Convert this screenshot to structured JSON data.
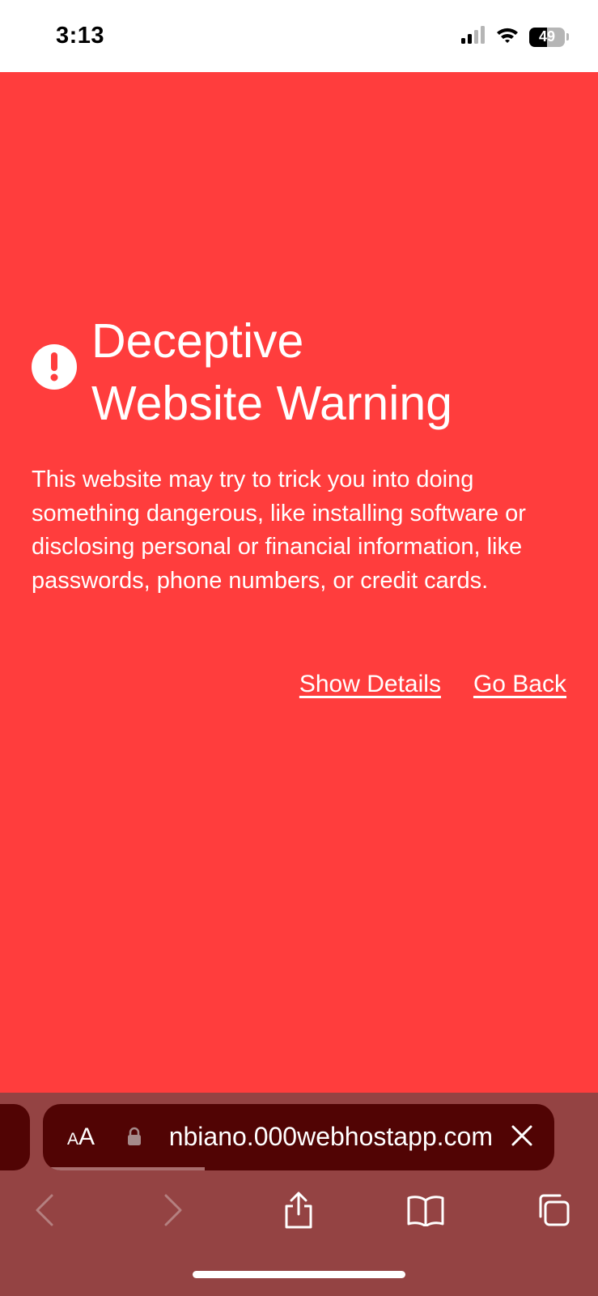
{
  "status_bar": {
    "time": "3:13",
    "battery_level": "49",
    "signal_icon": "cellular-signal-icon",
    "wifi_icon": "wifi-icon"
  },
  "warning": {
    "icon": "exclamation-icon",
    "title_line1": "Deceptive",
    "title_line2": "Website Warning",
    "body": "This website may try to trick you into doing something dangerous, like installing software or disclosing personal or financial information, like passwords, phone numbers, or credit cards.",
    "show_details_label": "Show Details",
    "go_back_label": "Go Back"
  },
  "browser": {
    "text_size_label_small": "A",
    "text_size_label_large": "A",
    "url": "nbiano.000webhostapp.com",
    "page_load_progress": 0.31,
    "icons": {
      "lock": "lock-icon",
      "close": "close-icon",
      "back": "back-chevron-icon",
      "forward": "forward-chevron-icon",
      "share": "share-icon",
      "bookmarks": "book-icon",
      "tabs": "tabs-icon"
    }
  },
  "colors": {
    "warning_background": "#ff3d3d",
    "toolbar_background": "#944343",
    "url_bar_background": "#510404"
  }
}
